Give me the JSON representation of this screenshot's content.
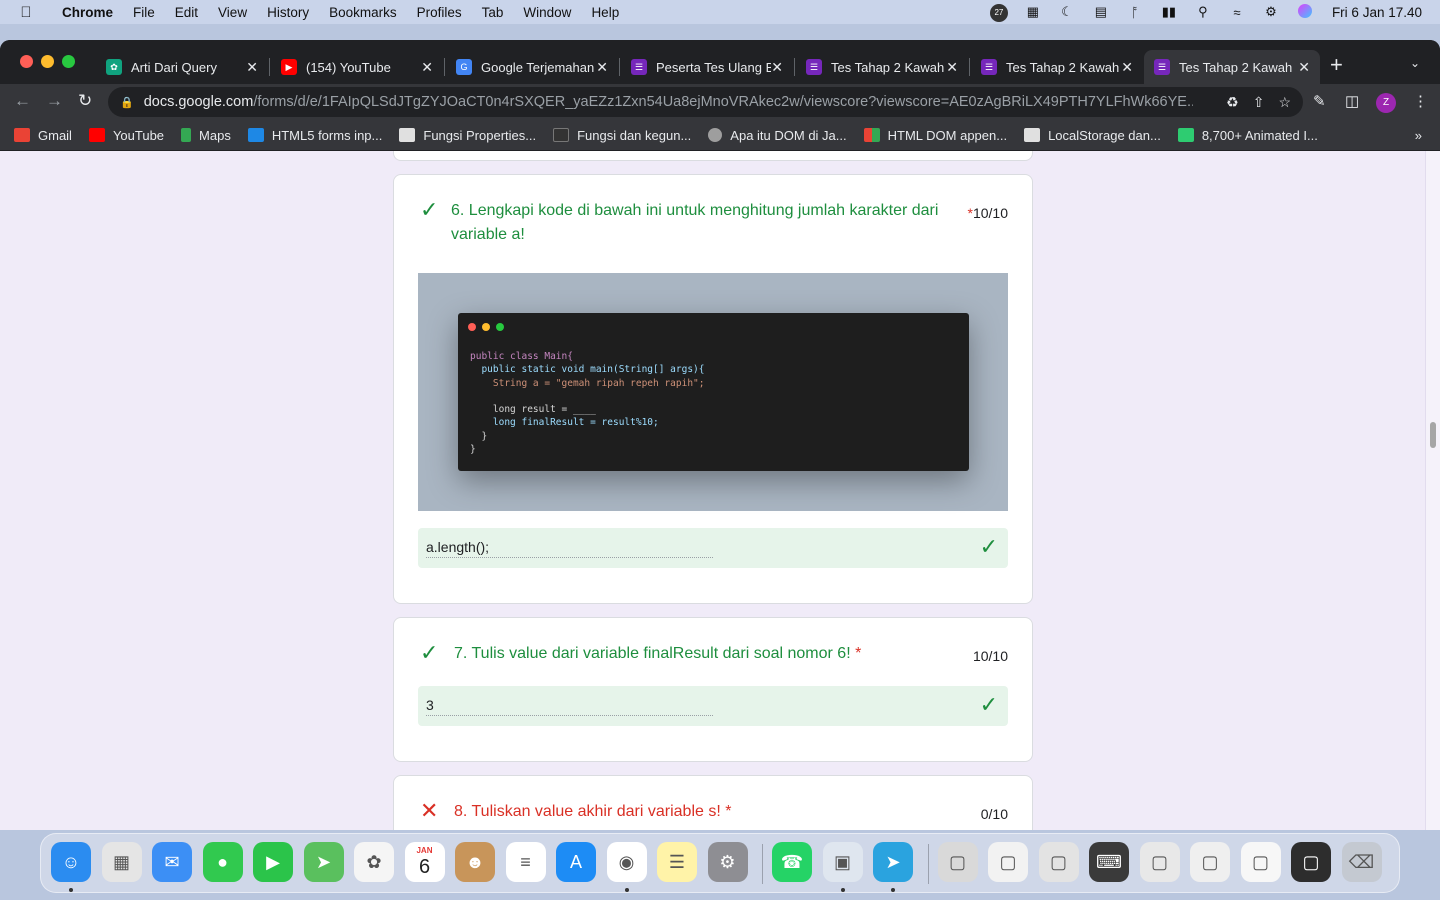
{
  "menubar": {
    "apple": "",
    "items": [
      "Chrome",
      "File",
      "Edit",
      "View",
      "History",
      "Bookmarks",
      "Profiles",
      "Tab",
      "Window",
      "Help"
    ],
    "status_icons": [
      "notification-count-icon",
      "input-menu-icon",
      "moon-icon",
      "screen-icon",
      "bluetooth-icon",
      "battery-icon",
      "spotlight-search-icon",
      "wifi-icon",
      "control-center-icon",
      "siri-icon"
    ],
    "notification_count": "27",
    "clock": "Fri 6 Jan  17.40"
  },
  "tabs": [
    {
      "label": "Arti Dari Query",
      "icon": "chatgpt-icon",
      "color": "#10a37f"
    },
    {
      "label": "(154) YouTube",
      "icon": "youtube-icon",
      "color": "#ff0000"
    },
    {
      "label": "Google Terjemahan",
      "icon": "translate-icon",
      "color": "#4285f4"
    },
    {
      "label": "Peserta Tes Ulang B",
      "icon": "forms-icon",
      "color": "#7627bb"
    },
    {
      "label": "Tes Tahap 2 Kawah",
      "icon": "forms-icon",
      "color": "#7627bb"
    },
    {
      "label": "Tes Tahap 2 Kawah",
      "icon": "forms-icon",
      "color": "#7627bb"
    },
    {
      "label": "Tes Tahap 2 Kawah",
      "icon": "forms-icon",
      "color": "#7627bb"
    }
  ],
  "address": {
    "host": "docs.google.com",
    "path": "/forms/d/e/1FAIpQLSdJTgZYJOaCT0n4rSXQER_yaEZz1Zxn54Ua8ejMnoVRAkec2w/viewscore?viewscore=AE0zAgBRiLX49PTH7YLFhWk66YE..."
  },
  "profile_initial": "Z",
  "bookmarks": [
    {
      "label": "Gmail",
      "color": "#ea4335"
    },
    {
      "label": "YouTube",
      "color": "#ff0000"
    },
    {
      "label": "Maps",
      "color": "#34a853"
    },
    {
      "label": "HTML5 forms inp...",
      "color": "#1e88e5"
    },
    {
      "label": "Fungsi Properties...",
      "color": "#e0e0e0"
    },
    {
      "label": "Fungsi dan kegun...",
      "color": "#333333"
    },
    {
      "label": "Apa itu DOM di Ja...",
      "color": "#9e9e9e"
    },
    {
      "label": "HTML DOM appen...",
      "color": "#f4b400"
    },
    {
      "label": "LocalStorage dan...",
      "color": "#e0e0e0"
    },
    {
      "label": "8,700+ Animated I...",
      "color": "#2ecc71"
    }
  ],
  "questions": [
    {
      "number_text": "6. Lengkapi kode di bawah ini untuk menghitung jumlah karakter dari variable a!",
      "required": "*",
      "score": "10/10",
      "status": "correct",
      "answer": "a.length();"
    },
    {
      "number_text": "7. Tulis value dari variable finalResult dari soal nomor 6!",
      "required": "*",
      "score": "10/10",
      "status": "correct",
      "answer": "3"
    },
    {
      "number_text": "8. Tuliskan value akhir dari variable s!",
      "required": "*",
      "score": "0/10",
      "status": "incorrect"
    }
  ],
  "code_lines": [
    "public class Main{",
    "  public static void main(String[] args){",
    "    String a = \"gemah ripah repeh rapih\";",
    "",
    "    long result = ____",
    "    long finalResult = result%10;",
    "  }",
    "}"
  ],
  "colors": {
    "correct": "#1e8e3e",
    "incorrect": "#d93025",
    "form_bg": "#f0ebf8",
    "answer_bg": "#e6f4ea"
  },
  "dock": {
    "apps": [
      {
        "name": "finder-icon",
        "color": "#2b8cf0"
      },
      {
        "name": "launchpad-icon",
        "color": "#e5e5e5"
      },
      {
        "name": "mail-icon",
        "color": "#3c8ff5"
      },
      {
        "name": "messages-icon",
        "color": "#31c94f"
      },
      {
        "name": "facetime-icon",
        "color": "#2bc44a"
      },
      {
        "name": "maps-icon",
        "color": "#5ac05e"
      },
      {
        "name": "photos-icon",
        "color": "#f5f5f5"
      },
      {
        "name": "calendar-icon",
        "color": "#ffffff"
      },
      {
        "name": "contacts-icon",
        "color": "#c8955a"
      },
      {
        "name": "reminders-icon",
        "color": "#ffffff"
      },
      {
        "name": "app-store-icon",
        "color": "#1d8cf5"
      },
      {
        "name": "chrome-icon",
        "color": "#ffffff"
      },
      {
        "name": "notes-icon",
        "color": "#fff3a8"
      },
      {
        "name": "system-preferences-icon",
        "color": "#8e8e93"
      },
      {
        "name": "whatsapp-icon",
        "color": "#25d366"
      },
      {
        "name": "preview-icon",
        "color": "#dfe6ef"
      },
      {
        "name": "telegram-icon",
        "color": "#2aa3df"
      },
      {
        "name": "window-thumb-icon",
        "color": "#d9d9d9"
      },
      {
        "name": "window-thumb-icon",
        "color": "#f2f2f2"
      },
      {
        "name": "window-thumb-icon",
        "color": "#e3e3e3"
      },
      {
        "name": "keyboard-thumb-icon",
        "color": "#3a3a3a"
      },
      {
        "name": "window-thumb-icon",
        "color": "#e8e8e8"
      },
      {
        "name": "window-thumb-icon",
        "color": "#efefef"
      },
      {
        "name": "window-thumb-icon",
        "color": "#f7f7f7"
      },
      {
        "name": "window-thumb-icon",
        "color": "#2d2d2d"
      },
      {
        "name": "trash-icon",
        "color": "#c4c9d1"
      }
    ],
    "calendar_month": "JAN",
    "calendar_day": "6"
  }
}
